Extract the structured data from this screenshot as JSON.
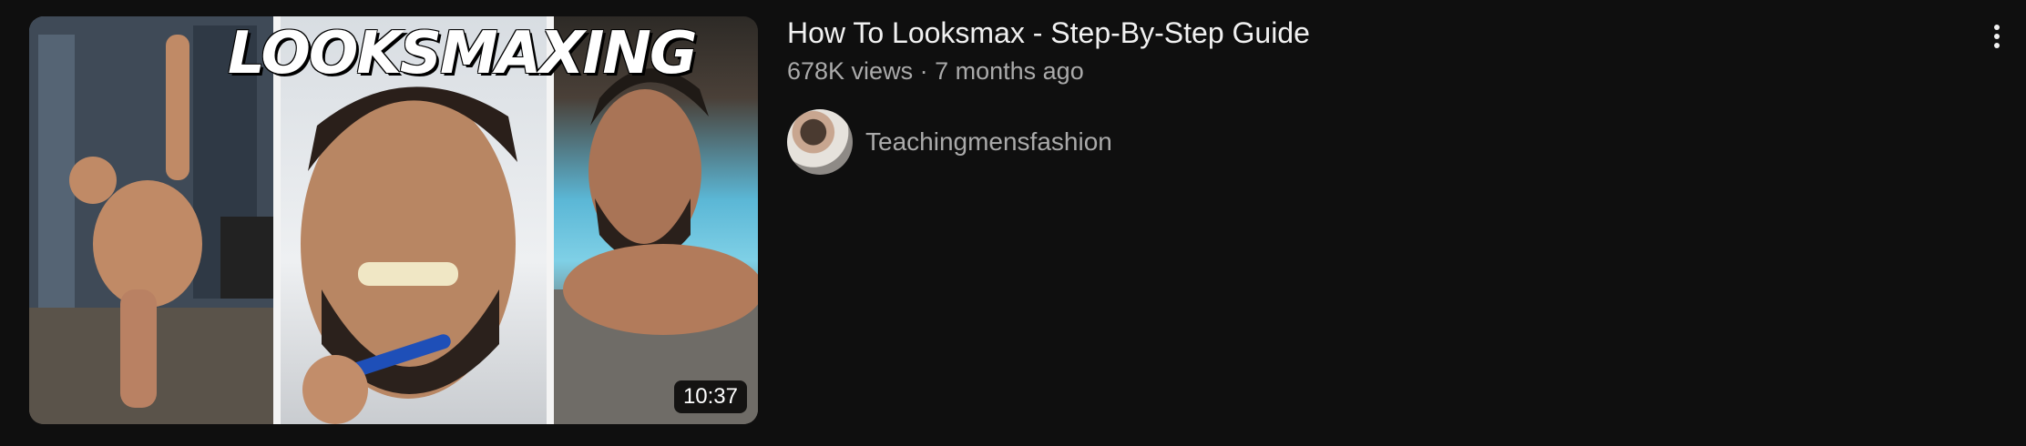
{
  "video": {
    "title": "How To Looksmax - Step-By-Step Guide",
    "views": "678K views",
    "separator": "·",
    "age": "7 months ago",
    "duration": "10:37",
    "thumbnail_text": "LOOKSMAXING"
  },
  "channel": {
    "name": "Teachingmensfashion"
  },
  "icons": {
    "more": "more-vert-icon"
  },
  "colors": {
    "background": "#0f0f0f",
    "title": "#f1f1f1",
    "secondary": "#aaaaaa"
  }
}
